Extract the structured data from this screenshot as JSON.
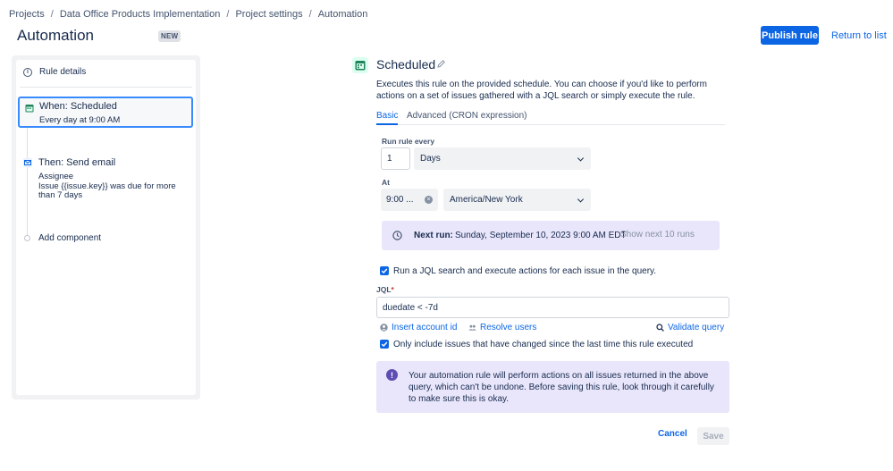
{
  "breadcrumb": [
    "Projects",
    "Data Office Products Implementation",
    "Project settings",
    "Automation"
  ],
  "breadcrumb_separator": "/",
  "header": {
    "title": "Automation",
    "badge": "NEW",
    "publish_label": "Publish rule",
    "return_label": "Return to list"
  },
  "rule_panel": {
    "details_label": "Rule details",
    "trigger_title": "When: Scheduled",
    "trigger_subtitle": "Every day at 9:00 AM",
    "action_title": "Then: Send email",
    "action_line1": "Assignee",
    "action_line2": "Issue {{issue.key}} was due for more than 7 days",
    "add_component": "Add component"
  },
  "schedule": {
    "title": "Scheduled",
    "description": "Executes this rule on the provided schedule. You can choose if you'd like to perform actions on a set of issues gathered with a JQL search or simply execute the rule.",
    "tabs": [
      "Basic",
      "Advanced (CRON expression)"
    ],
    "run_every_label": "Run rule every",
    "interval_value": "1",
    "interval_unit": "Days",
    "at_label": "At",
    "time_value": "9:00 ...",
    "timezone": "America/New York",
    "next_run_label": "Next run:",
    "next_run_value": "Sunday, September 10, 2023 9:00 AM EDT",
    "show_next_label": "Show next 10 runs",
    "jql_checkbox_label": "Run a JQL search and execute actions for each issue in the query.",
    "jql_label": "JQL",
    "jql_required": "*",
    "jql_value": "duedate < -7d",
    "insert_account_label": "Insert account id",
    "resolve_users_label": "Resolve users",
    "validate_query_label": "Validate query",
    "only_changed_label": "Only include issues that have changed since the last time this rule executed",
    "warning_text": "Your automation rule will perform actions on all issues returned in the above query, which can't be undone. Before saving this rule, look through it carefully to make sure this is okay.",
    "warning_glyph": "!",
    "cancel_label": "Cancel",
    "save_label": "Save"
  },
  "colors": {
    "primary": "#0c66e4",
    "selected_border": "#388bff",
    "info_panel": "#e9e6fb",
    "warning_icon": "#5e4db2"
  }
}
